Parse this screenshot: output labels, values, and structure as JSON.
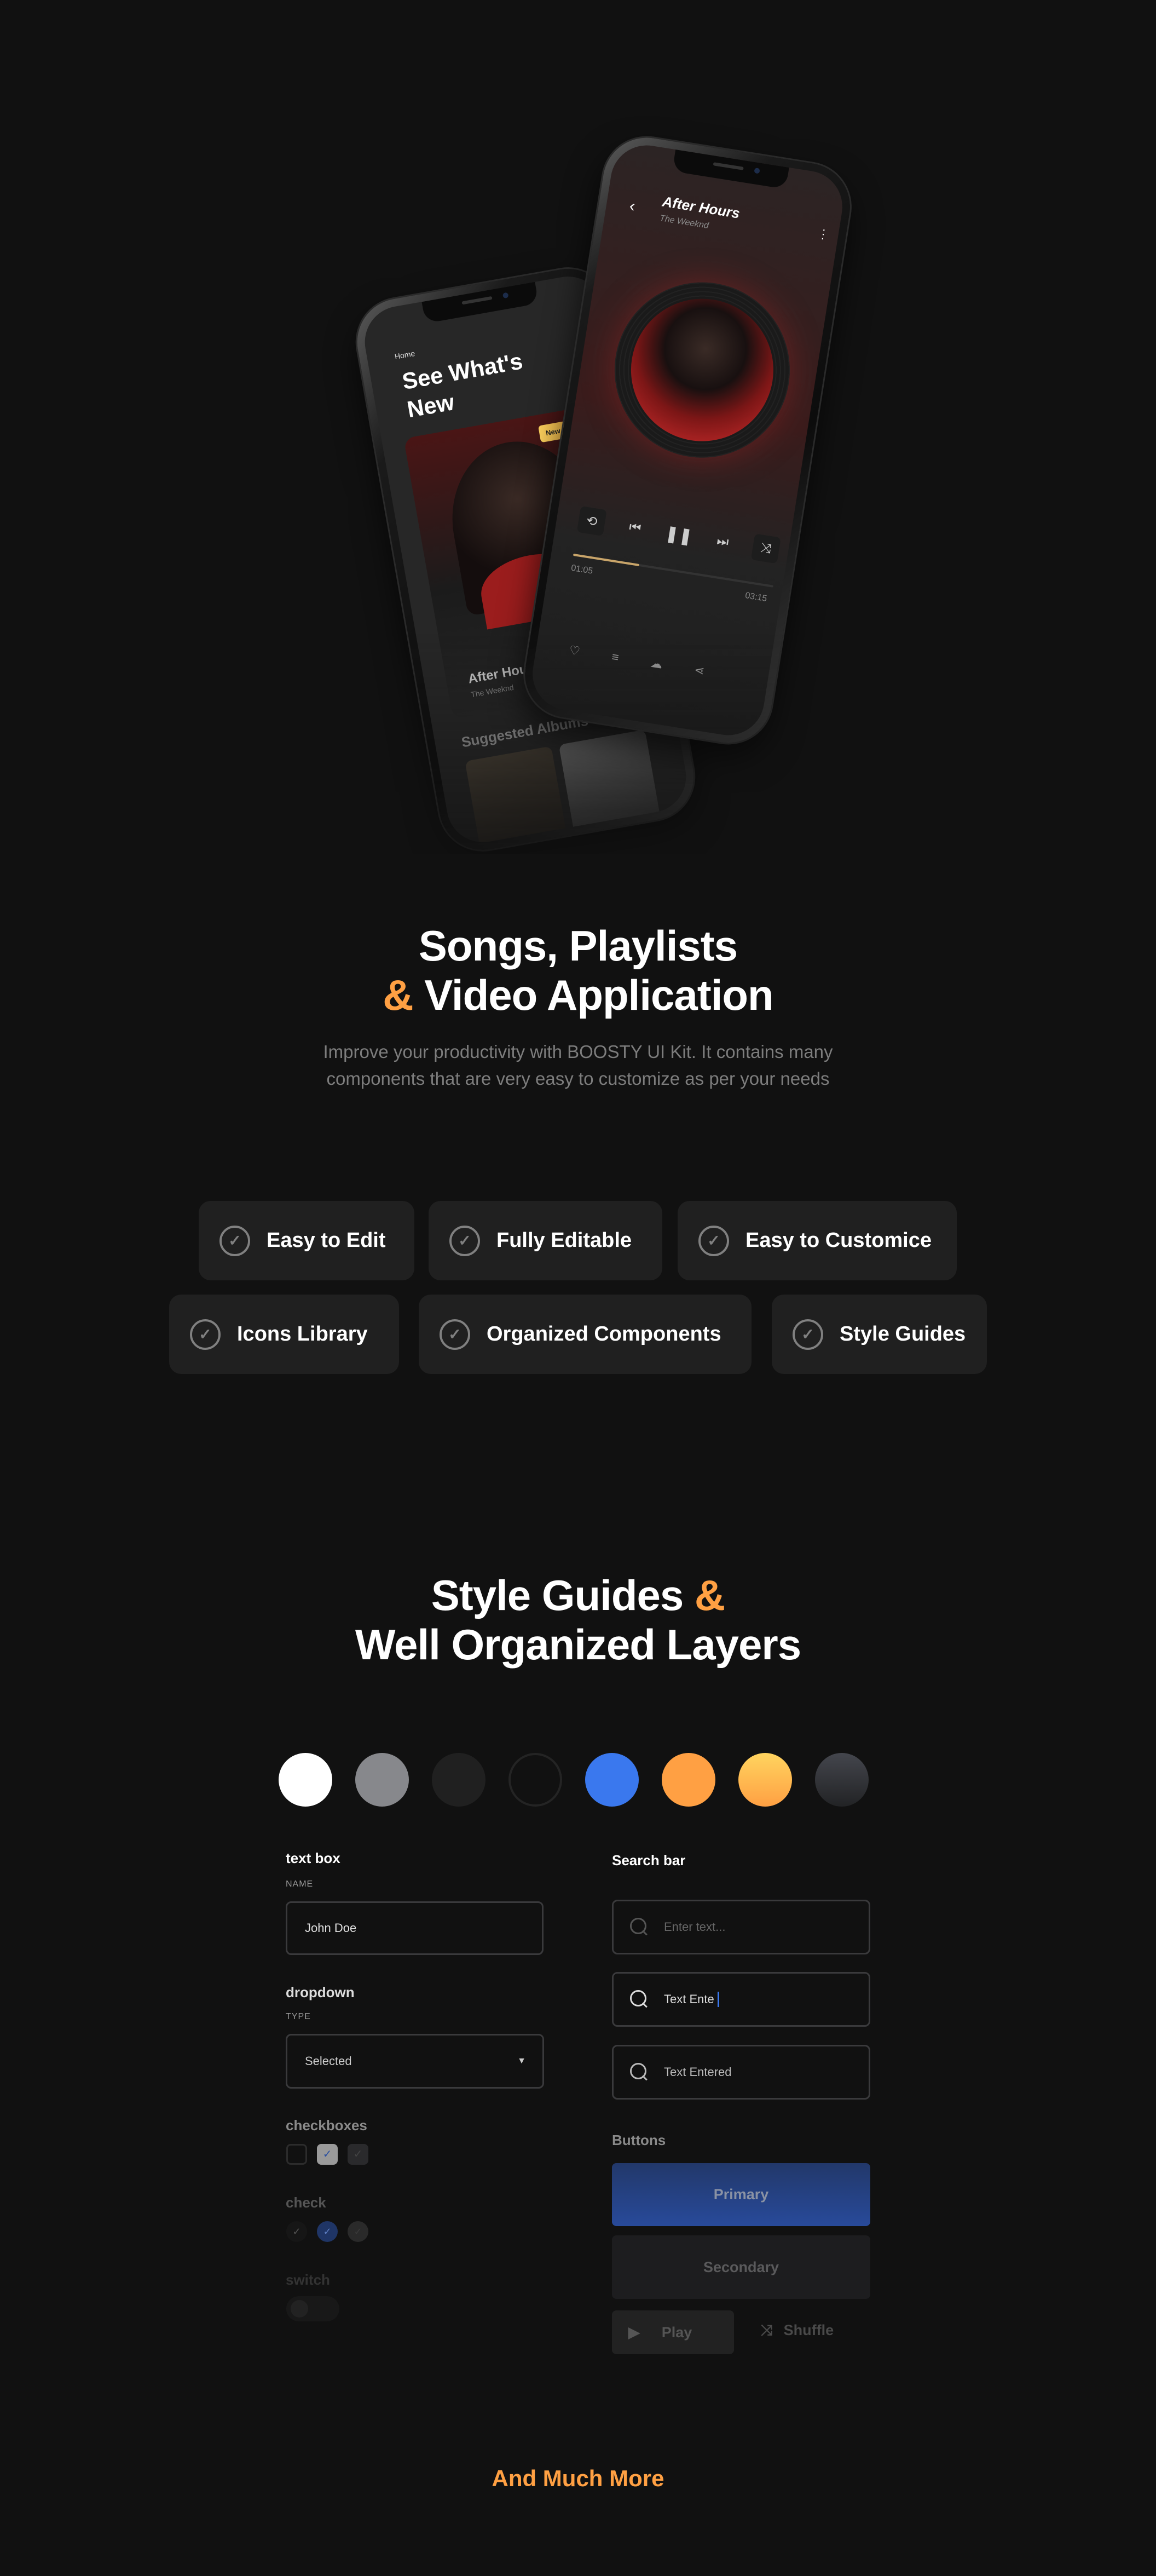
{
  "hero": {
    "home_screen": {
      "breadcrumb": "Home",
      "title_line1": "See What's",
      "title_line2": "New",
      "badge": "New Album",
      "card_title": "After Hours",
      "card_artist": "The Weeknd",
      "section_title": "Suggested Albums"
    },
    "player_screen": {
      "title": "After Hours",
      "artist": "The Weeknd",
      "elapsed": "01:05",
      "duration": "03:15",
      "progress_fraction": 0.33
    }
  },
  "intro": {
    "title_line1": "Songs, Playlists",
    "title_amp": "&",
    "title_line2": "Video Application",
    "description": "Improve your productivity with BOOSTY UI Kit. It contains many components that are very easy to customize as per your needs"
  },
  "features": [
    {
      "label": "Easy to Edit"
    },
    {
      "label": "Fully Editable"
    },
    {
      "label": "Easy to Customice"
    },
    {
      "label": "Icons Library"
    },
    {
      "label": "Organized Components"
    },
    {
      "label": "Style Guides"
    }
  ],
  "style_guides": {
    "title_line1": "Style Guides",
    "title_amp": "&",
    "title_line2": "Well Organized Layers",
    "colors": [
      "#ffffff",
      "#87888c",
      "#202020",
      "#111111",
      "#3a78ee",
      "#ffa043",
      "#ffd45f",
      "#3a3b40"
    ],
    "text_box": {
      "heading": "text box",
      "label": "NAME",
      "value": "John Doe"
    },
    "dropdown": {
      "heading": "dropdown",
      "label": "TYPE",
      "value": "Selected"
    },
    "checkboxes": {
      "heading": "checkboxes"
    },
    "check": {
      "heading": "check"
    },
    "switch": {
      "heading": "switch"
    },
    "search_bar": {
      "heading": "Search bar",
      "placeholder": "Enter text...",
      "typing_value": "Text Ente",
      "entered_value": "Text Entered"
    },
    "buttons": {
      "heading": "Buttons",
      "primary": "Primary",
      "secondary": "Secondary",
      "play": "Play",
      "shuffle": "Shuffle"
    }
  },
  "footer": {
    "text": "And Much More"
  },
  "accent_color": "#ffa043"
}
